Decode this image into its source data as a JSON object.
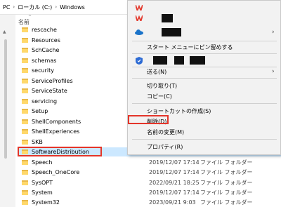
{
  "breadcrumb": {
    "items": [
      "PC",
      "ローカル (C:)",
      "Windows"
    ],
    "separator": "›"
  },
  "columns": {
    "name": "名前"
  },
  "rows": [
    {
      "name": "rescache",
      "date": "",
      "type": ""
    },
    {
      "name": "Resources",
      "date": "",
      "type": ""
    },
    {
      "name": "SchCache",
      "date": "",
      "type": ""
    },
    {
      "name": "schemas",
      "date": "",
      "type": ""
    },
    {
      "name": "security",
      "date": "",
      "type": ""
    },
    {
      "name": "ServiceProfiles",
      "date": "",
      "type": ""
    },
    {
      "name": "ServiceState",
      "date": "",
      "type": ""
    },
    {
      "name": "servicing",
      "date": "",
      "type": ""
    },
    {
      "name": "Setup",
      "date": "",
      "type": ""
    },
    {
      "name": "ShellComponents",
      "date": "",
      "type": ""
    },
    {
      "name": "ShellExperiences",
      "date": "",
      "type": ""
    },
    {
      "name": "SKB",
      "date": "",
      "type": ""
    },
    {
      "name": "SoftwareDistribution",
      "date": "",
      "type": ""
    },
    {
      "name": "Speech",
      "date": "2019/12/07 17:14",
      "type": "ファイル フォルダー"
    },
    {
      "name": "Speech_OneCore",
      "date": "2019/12/07 17:14",
      "type": "ファイル フォルダー"
    },
    {
      "name": "SysOPT",
      "date": "2022/09/21 18:25",
      "type": "ファイル フォルダー"
    },
    {
      "name": "System",
      "date": "2019/12/07 17:14",
      "type": "ファイル フォルダー"
    },
    {
      "name": "System32",
      "date": "2023/09/21 9:03",
      "type": "ファイル フォルダー"
    }
  ],
  "context_menu": {
    "pin_start": "スタート メニューにピン留めする",
    "send_to": "送る(N)",
    "cut": "切り取り(T)",
    "copy": "コピー(C)",
    "create_shortcut": "ショートカットの作成(S)",
    "delete": "削除(D)",
    "rename": "名前の変更(M)",
    "properties": "プロパティ(R)"
  },
  "colors": {
    "highlight_red": "#e4352a",
    "selection": "#cce8ff",
    "folder": "#ffd86b"
  },
  "icons": [
    "wps-icon",
    "onedrive-icon",
    "shield-icon",
    "folder-icon",
    "chevron-right-icon"
  ]
}
